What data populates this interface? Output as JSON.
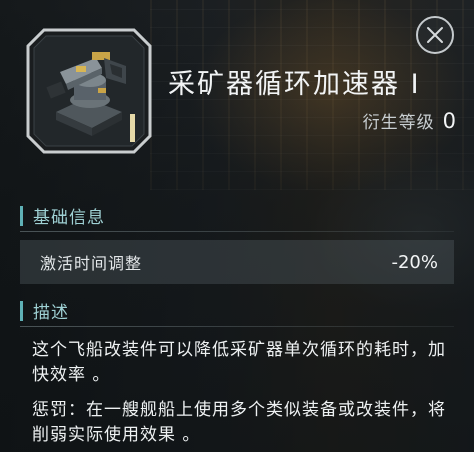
{
  "item": {
    "title": "采矿器循环加速器 I",
    "meta_label": "衍生等级",
    "meta_value": "0",
    "icon": "mining-turret-module-icon"
  },
  "close": {
    "icon": "close-x-icon"
  },
  "sections": {
    "basic": {
      "title": "基础信息"
    },
    "description": {
      "title": "描述"
    }
  },
  "stats": [
    {
      "label": "激活时间调整",
      "value": "-20%"
    }
  ],
  "description": {
    "text": "这个飞船改装件可以降低采矿器单次循环的耗时，加快效率 。",
    "penalty": "惩罚：在一艘舰船上使用多个类似装备或改装件，将削弱实际使用效果 。"
  },
  "colors": {
    "accent": "#5fb1b6",
    "section_text": "#9fd1d4",
    "stat_row_bg": "#4a5357"
  }
}
